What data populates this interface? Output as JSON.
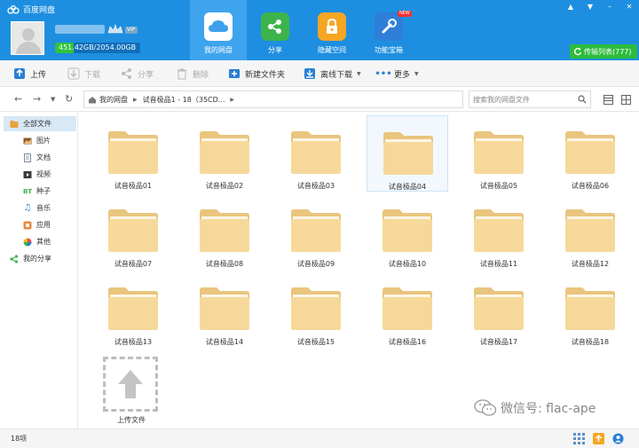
{
  "app": {
    "title": "百度网盘"
  },
  "user": {
    "vip_label": "VIP",
    "storage": "451.42GB/2054.00GB",
    "storage_used_fraction": 0.22
  },
  "nav_tabs": [
    {
      "label": "我的网盘",
      "icon": "cloud-icon",
      "active": true
    },
    {
      "label": "分享",
      "icon": "share-icon",
      "active": false
    },
    {
      "label": "隐藏空间",
      "icon": "lock-icon",
      "active": false
    },
    {
      "label": "功能宝箱",
      "icon": "toolbox-icon",
      "active": false,
      "badge": "NEW"
    }
  ],
  "transfer": {
    "label": "传输列表(777)"
  },
  "toolbar": {
    "upload": "上传",
    "download": "下载",
    "share": "分享",
    "delete": "删除",
    "new_folder": "新建文件夹",
    "offline_download": "离线下载",
    "more": "更多"
  },
  "breadcrumb": {
    "root": "我的网盘",
    "current": "试音极品1 - 18（35CD..."
  },
  "search": {
    "placeholder": "搜索我的网盘文件"
  },
  "sidebar": {
    "items": [
      {
        "label": "全部文件",
        "icon": "all-files-icon",
        "active": true
      },
      {
        "label": "图片",
        "icon": "image-icon"
      },
      {
        "label": "文档",
        "icon": "document-icon"
      },
      {
        "label": "视频",
        "icon": "video-icon"
      },
      {
        "label": "种子",
        "icon": "torrent-icon",
        "glyph": "BT"
      },
      {
        "label": "音乐",
        "icon": "music-icon"
      },
      {
        "label": "应用",
        "icon": "app-icon"
      },
      {
        "label": "其他",
        "icon": "other-icon"
      },
      {
        "label": "我的分享",
        "icon": "share-icon"
      }
    ]
  },
  "files": [
    "试音极品01",
    "试音极品02",
    "试音极品03",
    "试音极品04",
    "试音极品05",
    "试音极品06",
    "试音极品07",
    "试音极品08",
    "试音极品09",
    "试音极品10",
    "试音极品11",
    "试音极品12",
    "试音极品13",
    "试音极品14",
    "试音极品15",
    "试音极品16",
    "试音极品17",
    "试音极品18"
  ],
  "selected_file": "试音极品04",
  "upload_tile": {
    "label": "上传文件"
  },
  "status": {
    "count": "18项"
  },
  "watermark": {
    "text": "微信号: flac-ape"
  },
  "colors": {
    "header": "#1e8fe0",
    "active_tab": "#3fa4ee",
    "folder": "#f5d99a",
    "transfer_button": "#2dbc3c"
  }
}
